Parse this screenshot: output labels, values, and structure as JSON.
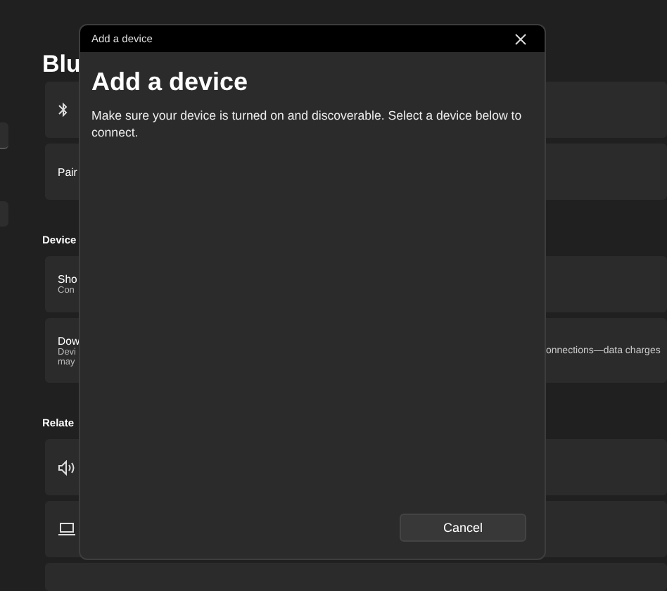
{
  "settings": {
    "heading": "Blu",
    "groups": [
      {
        "cards": [
          {
            "kind": "bluetooth"
          },
          {
            "kind": "text",
            "title": "Pair"
          }
        ]
      },
      {
        "label": "Device",
        "cards": [
          {
            "kind": "text",
            "title": "Sho",
            "subtitle": [
              "Con"
            ]
          },
          {
            "kind": "text",
            "title": "Dow",
            "subtitle": [
              "Devi",
              "may"
            ],
            "trailing": "onnections—data charges"
          }
        ]
      },
      {
        "label": "Relate",
        "cards": [
          {
            "kind": "speaker"
          },
          {
            "kind": "laptop"
          },
          {
            "kind": "blank"
          }
        ]
      }
    ]
  },
  "dialog": {
    "title_bar": "Add a device",
    "heading": "Add a device",
    "message": "Make sure your device is turned on and discoverable. Select a device below to connect.",
    "buttons": [
      "Cancel"
    ]
  }
}
